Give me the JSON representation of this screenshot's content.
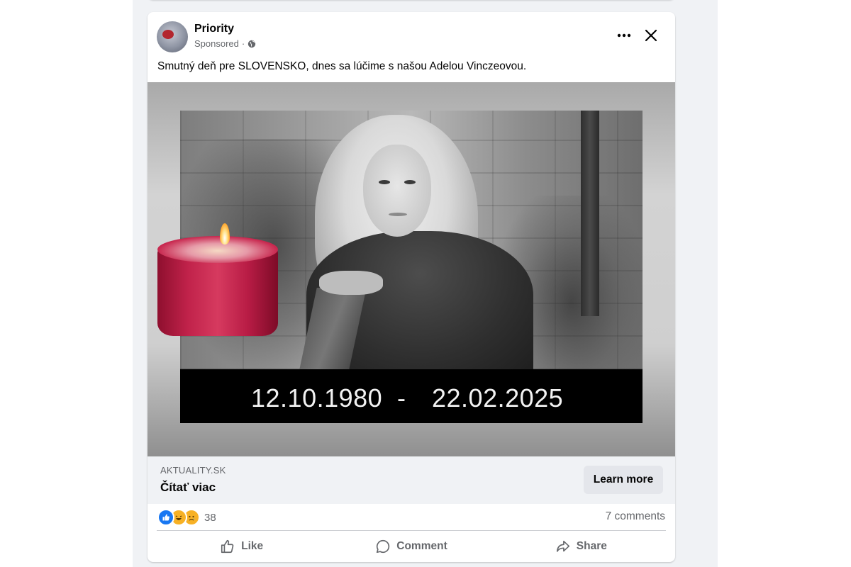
{
  "post": {
    "page_name": "Priority",
    "sponsored_label": "Sponsored",
    "meta_separator": "·",
    "text": "Smutný deň pre SLOVENSKO, dnes sa lúčime s našou Adelou Vinczeovou.",
    "icons": {
      "more": "more-options-icon",
      "close": "close-icon",
      "audience": "globe-icon"
    }
  },
  "media": {
    "date_born": "12.10.1980",
    "date_separator": "-",
    "date_died": "22.02.2025"
  },
  "link": {
    "domain": "AKTUALITY.SK",
    "title": "Čítať viac",
    "cta_label": "Learn more"
  },
  "engagement": {
    "reaction_types": [
      "like",
      "haha",
      "sad"
    ],
    "reaction_count": "38",
    "comments": "7 comments"
  },
  "actions": {
    "like": "Like",
    "comment": "Comment",
    "share": "Share"
  },
  "colors": {
    "feed_background": "#f0f2f5",
    "card_background": "#ffffff",
    "secondary_text": "#65676b",
    "like_blue": "#1877f2",
    "emoji_yellow": "#f7b125",
    "candle_red": "#c0224a"
  }
}
